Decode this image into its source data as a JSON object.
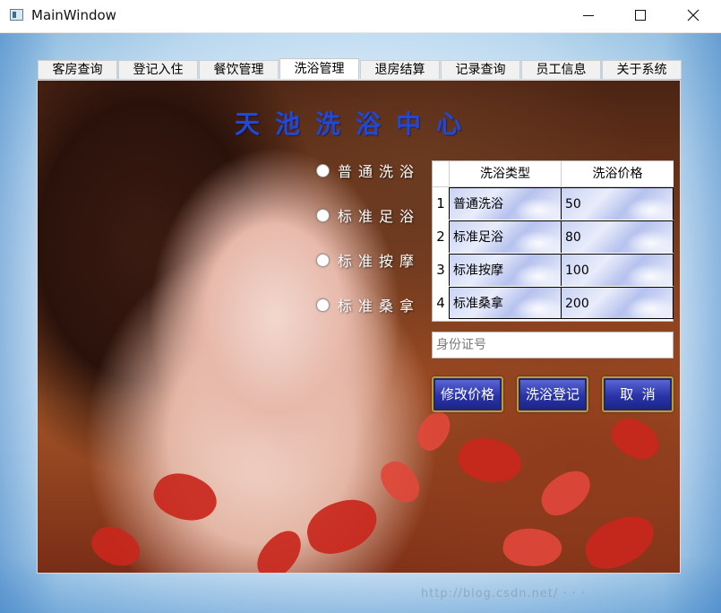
{
  "window": {
    "title": "MainWindow"
  },
  "tabs": [
    {
      "label": "客房查询"
    },
    {
      "label": "登记入住"
    },
    {
      "label": "餐饮管理"
    },
    {
      "label": "洗浴管理"
    },
    {
      "label": "退房结算"
    },
    {
      "label": "记录查询"
    },
    {
      "label": "员工信息"
    },
    {
      "label": "关于系统"
    }
  ],
  "active_tab": "洗浴管理",
  "page": {
    "title": "天池洗浴中心",
    "options": [
      {
        "label": "普通洗浴",
        "selected": false
      },
      {
        "label": "标准足浴",
        "selected": false
      },
      {
        "label": "标准按摩",
        "selected": false
      },
      {
        "label": "标准桑拿",
        "selected": false
      }
    ],
    "table": {
      "headers": [
        "洗浴类型",
        "洗浴价格"
      ],
      "rows": [
        {
          "num": "1",
          "type": "普通洗浴",
          "price": "50"
        },
        {
          "num": "2",
          "type": "标准足浴",
          "price": "80"
        },
        {
          "num": "3",
          "type": "标准按摩",
          "price": "100"
        },
        {
          "num": "4",
          "type": "标准桑拿",
          "price": "200"
        }
      ]
    },
    "id_input": {
      "placeholder": "身份证号",
      "value": ""
    },
    "buttons": {
      "modify": "修改价格",
      "register": "洗浴登记",
      "cancel": "取  消"
    }
  },
  "colors": {
    "title_blue": "#1f49d6",
    "button_blue": "#2a34a8",
    "button_border": "#b89b3a"
  }
}
